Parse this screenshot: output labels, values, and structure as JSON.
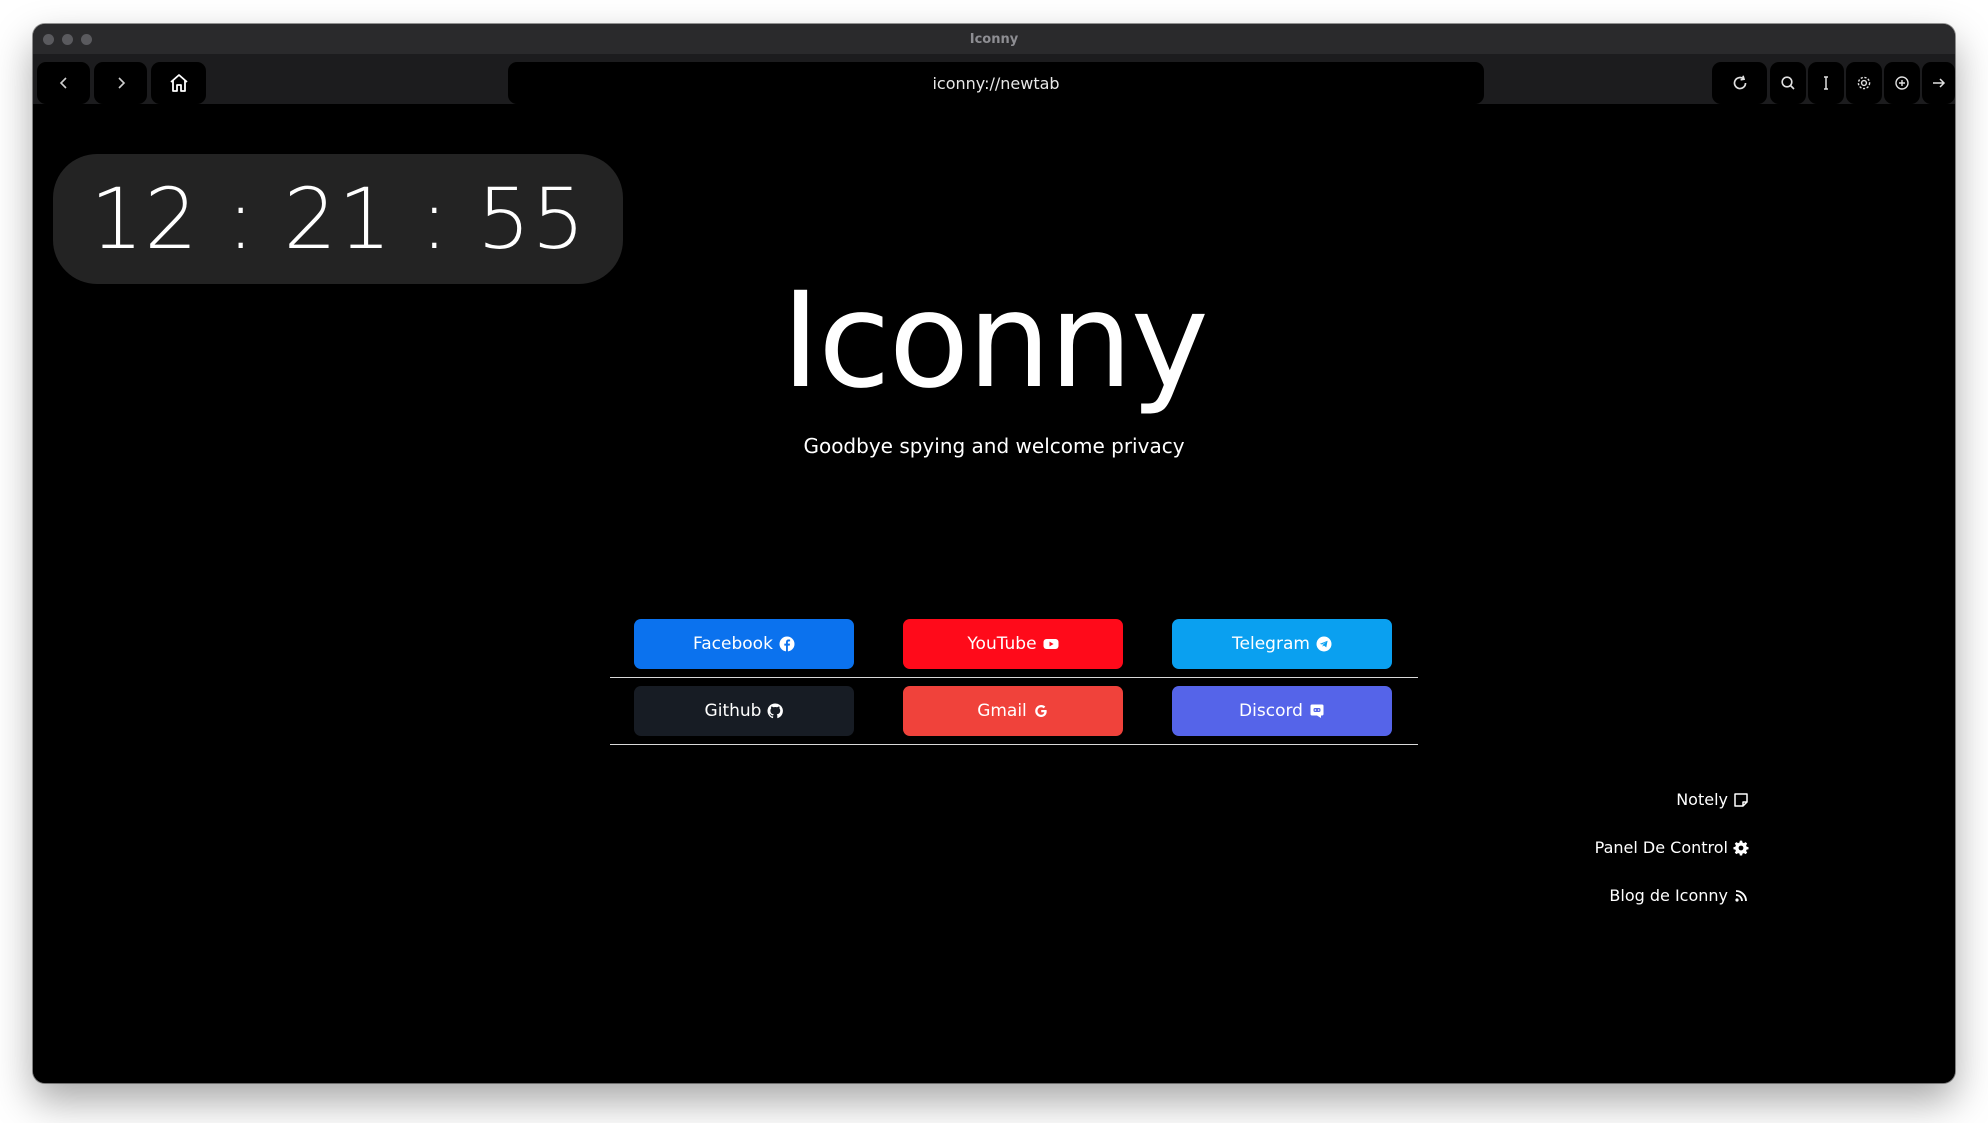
{
  "window": {
    "title": "Iconny"
  },
  "toolbar": {
    "url": "iconny://newtab",
    "icons": [
      "back-icon",
      "forward-icon",
      "home-icon",
      "reload-icon",
      "search-icon",
      "text-cursor-icon",
      "settings-icon",
      "add-icon",
      "exit-icon"
    ]
  },
  "clock": {
    "time": "12 : 21 : 55"
  },
  "hero": {
    "title": "Iconny",
    "tagline": "Goodbye spying and welcome privacy"
  },
  "links": [
    {
      "label": "Facebook",
      "color": "#0b72ee",
      "icon": "facebook-icon"
    },
    {
      "label": "YouTube",
      "color": "#ff0a1a",
      "icon": "youtube-icon"
    },
    {
      "label": "Telegram",
      "color": "#0aa0f0",
      "icon": "telegram-icon"
    },
    {
      "label": "Github",
      "color": "#171c24",
      "icon": "github-icon"
    },
    {
      "label": "Gmail",
      "color": "#f0423b",
      "icon": "google-icon"
    },
    {
      "label": "Discord",
      "color": "#5564e9",
      "icon": "discord-icon"
    }
  ],
  "side_links": [
    {
      "label": "Notely",
      "icon": "note-icon"
    },
    {
      "label": "Panel De Control",
      "icon": "gear-icon"
    },
    {
      "label": "Blog de Iconny",
      "icon": "rss-icon"
    }
  ]
}
